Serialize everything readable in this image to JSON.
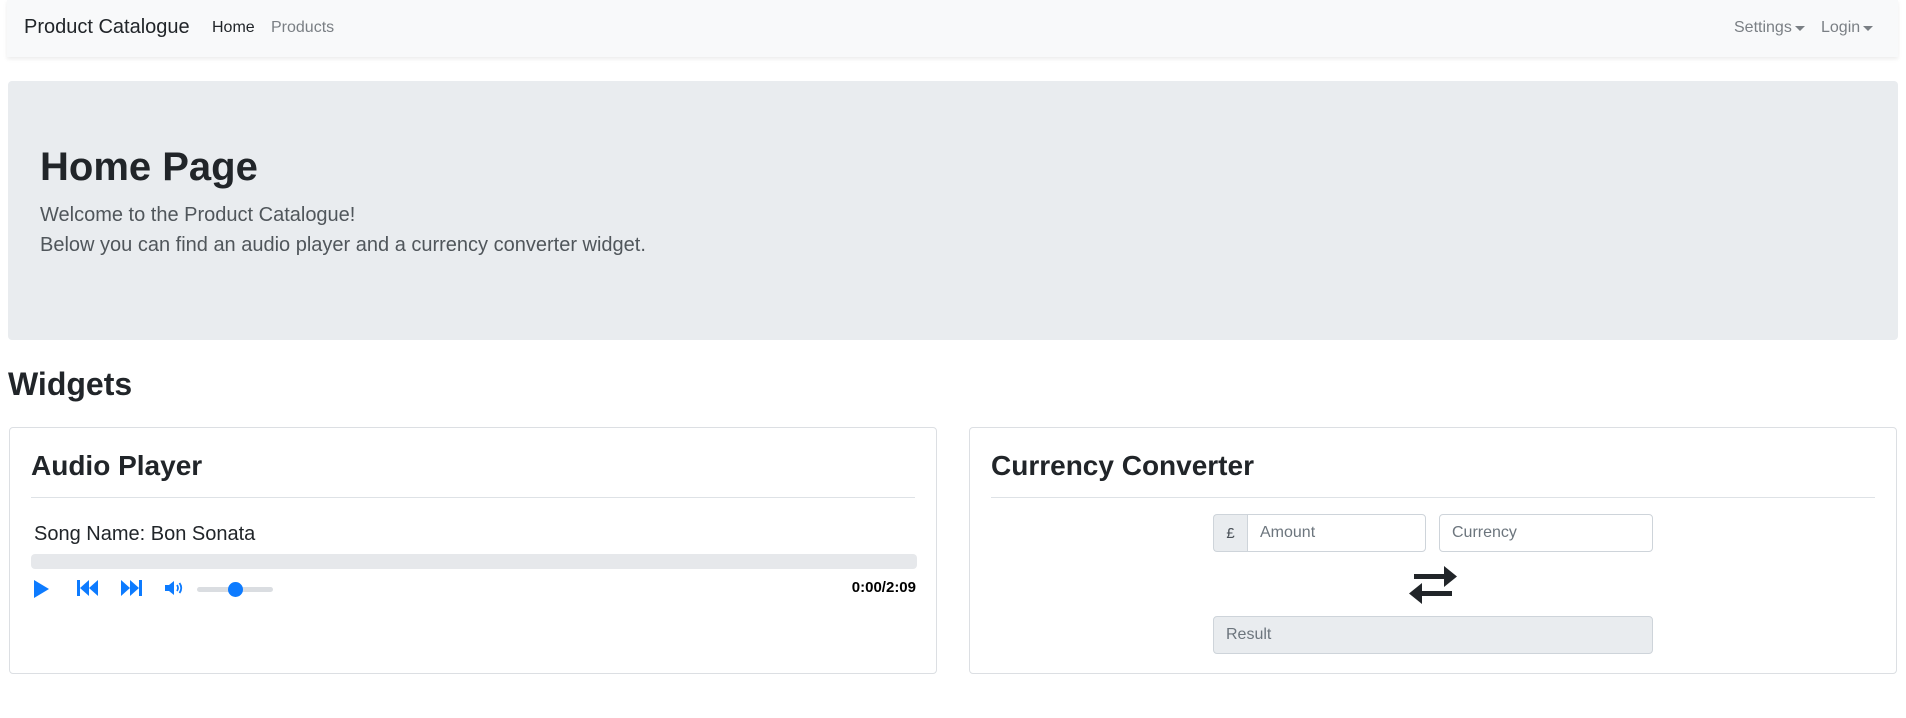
{
  "navbar": {
    "brand": "Product Catalogue",
    "links": [
      {
        "label": "Home"
      },
      {
        "label": "Products"
      }
    ],
    "right": [
      {
        "label": "Settings"
      },
      {
        "label": "Login"
      }
    ]
  },
  "jumbotron": {
    "title": "Home Page",
    "line1": "Welcome to the Product Catalogue!",
    "line2": "Below you can find an audio player and a currency converter widget."
  },
  "section_title": "Widgets",
  "audio_player": {
    "title": "Audio Player",
    "song_name": "Song Name: Bon Sonata",
    "time_display": "0:00/2:09",
    "progress_percent": 0,
    "volume_percent": 50,
    "accent_color": "#0d7bff",
    "icons": [
      "play-icon",
      "skip-back-icon",
      "skip-forward-icon",
      "volume-icon"
    ]
  },
  "currency_converter": {
    "title": "Currency Converter",
    "currency_symbol": "£",
    "amount_placeholder": "Amount",
    "currency_placeholder": "Currency",
    "result_placeholder": "Result",
    "swap_icon": "swap-arrows-icon"
  }
}
